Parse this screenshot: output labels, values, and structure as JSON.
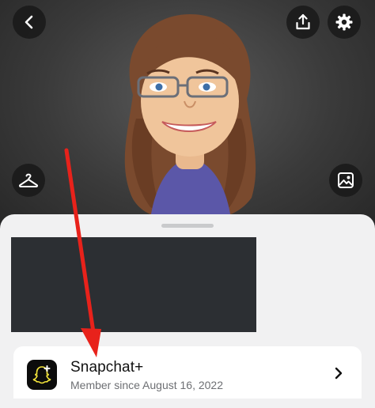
{
  "header": {
    "back_icon": "chevron-left-icon",
    "share_icon": "share-upload-icon",
    "settings_icon": "gear-icon",
    "outfit_icon": "hanger-icon",
    "backdrop_icon": "image-frame-icon"
  },
  "avatar": {
    "description_icon": "bitmoji-avatar"
  },
  "subscription_card": {
    "title": "Snapchat+",
    "subtitle": "Member since August 16, 2022",
    "icon": "snapchat-plus-ghost-icon",
    "chevron_icon": "chevron-right-icon"
  },
  "colors": {
    "annotation_arrow": "#e8221b",
    "sheet_bg": "#f1f1f2",
    "card_bg": "#ffffff",
    "redacted_block": "#2c2f33"
  }
}
